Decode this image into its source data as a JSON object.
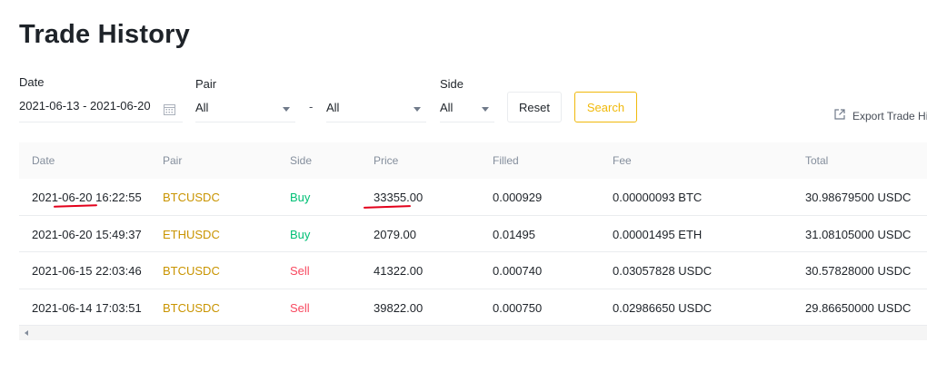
{
  "page": {
    "title": "Trade History"
  },
  "filters": {
    "date_label": "Date",
    "date_value": "2021-06-13 - 2021-06-20",
    "pair_label": "Pair",
    "pair_from": "All",
    "separator": "-",
    "pair_to": "All",
    "side_label": "Side",
    "side_value": "All",
    "reset_label": "Reset",
    "search_label": "Search"
  },
  "export": {
    "label": "Export Trade Hi"
  },
  "table": {
    "headers": [
      "Date",
      "Pair",
      "Side",
      "Price",
      "Filled",
      "Fee",
      "Total"
    ],
    "rows": [
      {
        "date": "2021-06-20 16:22:55",
        "pair": "BTCUSDC",
        "side": "Buy",
        "price": "33355.00",
        "filled": "0.000929",
        "fee": "0.00000093 BTC",
        "total": "30.98679500 USDC"
      },
      {
        "date": "2021-06-20 15:49:37",
        "pair": "ETHUSDC",
        "side": "Buy",
        "price": "2079.00",
        "filled": "0.01495",
        "fee": "0.00001495 ETH",
        "total": "31.08105000 USDC"
      },
      {
        "date": "2021-06-15 22:03:46",
        "pair": "BTCUSDC",
        "side": "Sell",
        "price": "41322.00",
        "filled": "0.000740",
        "fee": "0.03057828 USDC",
        "total": "30.57828000 USDC"
      },
      {
        "date": "2021-06-14 17:03:51",
        "pair": "BTCUSDC",
        "side": "Sell",
        "price": "39822.00",
        "filled": "0.000750",
        "fee": "0.02986650 USDC",
        "total": "29.86650000 USDC"
      }
    ]
  },
  "colors": {
    "accent": "#f0b90b",
    "pair": "#c99400",
    "buy": "#02c076",
    "sell": "#f84960",
    "annotation": "#e3001b"
  }
}
